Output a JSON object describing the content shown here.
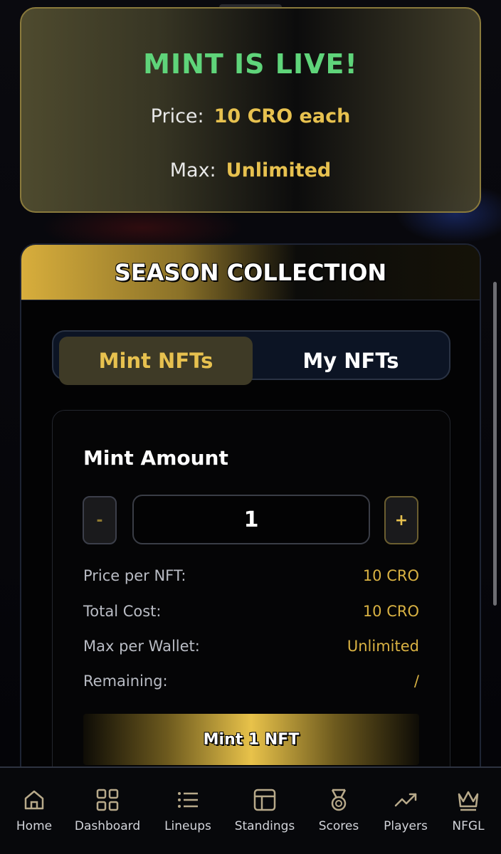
{
  "mint_banner": {
    "title": "MINT IS LIVE!",
    "price_label": "Price:",
    "price_value": "10 CRO each",
    "max_label": "Max:",
    "max_value": "Unlimited"
  },
  "season": {
    "title": "SEASON COLLECTION",
    "tabs": [
      {
        "label": "Mint NFTs",
        "active": true
      },
      {
        "label": "My NFTs",
        "active": false
      }
    ],
    "mint_amount_label": "Mint Amount",
    "minus_label": "-",
    "plus_label": "+",
    "quantity": "1",
    "details": [
      {
        "key": "Price per NFT:",
        "value": "10 CRO"
      },
      {
        "key": "Total Cost:",
        "value": "10 CRO"
      },
      {
        "key": "Max per Wallet:",
        "value": "Unlimited"
      },
      {
        "key": "Remaining:",
        "value": "/"
      }
    ],
    "mint_button": "Mint 1 NFT"
  },
  "nav": [
    {
      "label": "Home",
      "icon": "home-icon"
    },
    {
      "label": "Dashboard",
      "icon": "dashboard-icon"
    },
    {
      "label": "Lineups",
      "icon": "list-icon"
    },
    {
      "label": "Standings",
      "icon": "table-icon"
    },
    {
      "label": "Scores",
      "icon": "medal-icon"
    },
    {
      "label": "Players",
      "icon": "trend-icon"
    },
    {
      "label": "NFGL",
      "icon": "crown-icon"
    }
  ],
  "colors": {
    "accent_gold": "#e7c14f",
    "live_green": "#5fd47a",
    "background": "#05060a"
  }
}
